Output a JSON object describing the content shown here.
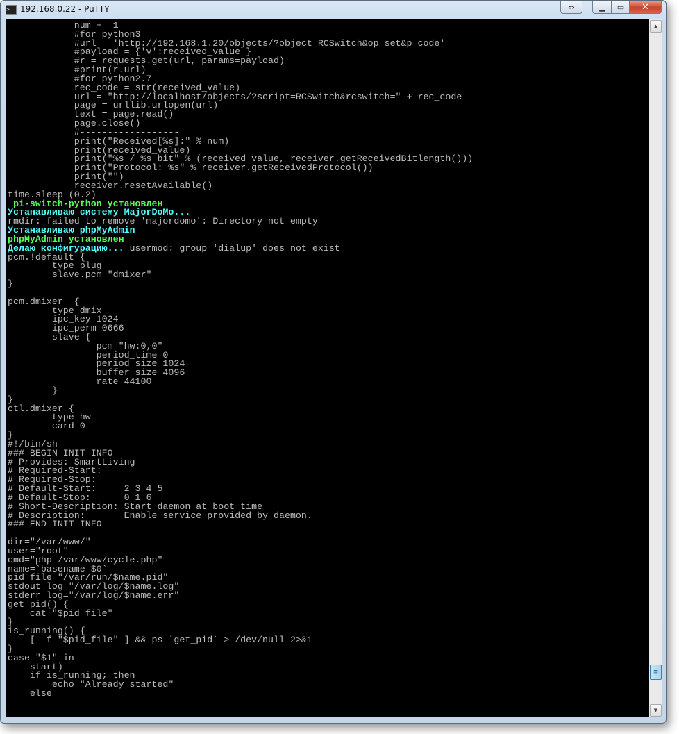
{
  "window": {
    "title": "192.168.0.22 - PuTTY",
    "buttons": {
      "resize": "⇔",
      "minimize": "▁",
      "maximize": "▭",
      "close": "✕"
    }
  },
  "colors": {
    "default": "#bbbbbb",
    "green": "#55ff55",
    "cyan": "#55ffff",
    "background": "#000000"
  },
  "scrollbar": {
    "position_percent": 96
  },
  "terminal": {
    "lines": [
      [
        {
          "t": "            num += 1"
        }
      ],
      [
        {
          "t": "            #for python3"
        }
      ],
      [
        {
          "t": "            #url = 'http://192.168.1.20/objects/?object=RCSwitch&op=set&p=code'"
        }
      ],
      [
        {
          "t": "            #payload = {'v':received_value }"
        }
      ],
      [
        {
          "t": "            #r = requests.get(url, params=payload)"
        }
      ],
      [
        {
          "t": "            #print(r.url)"
        }
      ],
      [
        {
          "t": "            #for python2.7"
        }
      ],
      [
        {
          "t": "            rec_code = str(received_value)"
        }
      ],
      [
        {
          "t": "            url = \"http://localhost/objects/?script=RCSwitch&rcswitch=\" + rec_code"
        }
      ],
      [
        {
          "t": "            page = urllib.urlopen(url)"
        }
      ],
      [
        {
          "t": "            text = page.read()"
        }
      ],
      [
        {
          "t": "            page.close()"
        }
      ],
      [
        {
          "t": "            #------------------"
        }
      ],
      [
        {
          "t": "            print(\"Received[%s]:\" % num)"
        }
      ],
      [
        {
          "t": "            print(received_value)"
        }
      ],
      [
        {
          "t": "            print(\"%s / %s bit\" % (received_value, receiver.getReceivedBitlength()))"
        }
      ],
      [
        {
          "t": "            print(\"Protocol: %s\" % receiver.getReceivedProtocol())"
        }
      ],
      [
        {
          "t": "            print(\"\")"
        }
      ],
      [
        {
          "t": "            receiver.resetAvailable()"
        }
      ],
      [
        {
          "t": "time.sleep (0.2)"
        }
      ],
      [
        {
          "t": " pi-switch-python установлен",
          "c": "green",
          "b": true
        }
      ],
      [
        {
          "t": "Устанавливаю систему MajorDoMo...",
          "c": "cyan",
          "b": true
        }
      ],
      [
        {
          "t": "rmdir: failed to remove 'majordomo': Directory not empty"
        }
      ],
      [
        {
          "t": "Устанавливаю phpMyAdmin",
          "c": "cyan",
          "b": true
        }
      ],
      [
        {
          "t": "phpMyAdmin установлен",
          "c": "green",
          "b": true
        }
      ],
      [
        {
          "t": "Делаю конфигурацию...",
          "c": "cyan",
          "b": true
        },
        {
          "t": " usermod: group 'dialup' does not exist"
        }
      ],
      [
        {
          "t": "pcm.!default {"
        }
      ],
      [
        {
          "t": "        type plug"
        }
      ],
      [
        {
          "t": "        slave.pcm \"dmixer\""
        }
      ],
      [
        {
          "t": "}"
        }
      ],
      [
        {
          "t": ""
        }
      ],
      [
        {
          "t": "pcm.dmixer  {"
        }
      ],
      [
        {
          "t": "        type dmix"
        }
      ],
      [
        {
          "t": "        ipc_key 1024"
        }
      ],
      [
        {
          "t": "        ipc_perm 0666"
        }
      ],
      [
        {
          "t": "        slave {"
        }
      ],
      [
        {
          "t": "                pcm \"hw:0,0\""
        }
      ],
      [
        {
          "t": "                period_time 0"
        }
      ],
      [
        {
          "t": "                period_size 1024"
        }
      ],
      [
        {
          "t": "                buffer_size 4096"
        }
      ],
      [
        {
          "t": "                rate 44100"
        }
      ],
      [
        {
          "t": "        }"
        }
      ],
      [
        {
          "t": "}"
        }
      ],
      [
        {
          "t": "ctl.dmixer {"
        }
      ],
      [
        {
          "t": "        type hw"
        }
      ],
      [
        {
          "t": "        card 0"
        }
      ],
      [
        {
          "t": "}"
        }
      ],
      [
        {
          "t": "#!/bin/sh"
        }
      ],
      [
        {
          "t": "### BEGIN INIT INFO"
        }
      ],
      [
        {
          "t": "# Provides: SmartLiving"
        }
      ],
      [
        {
          "t": "# Required-Start:"
        }
      ],
      [
        {
          "t": "# Required-Stop:"
        }
      ],
      [
        {
          "t": "# Default-Start:     2 3 4 5"
        }
      ],
      [
        {
          "t": "# Default-Stop:      0 1 6"
        }
      ],
      [
        {
          "t": "# Short-Description: Start daemon at boot time"
        }
      ],
      [
        {
          "t": "# Description:       Enable service provided by daemon."
        }
      ],
      [
        {
          "t": "### END INIT INFO"
        }
      ],
      [
        {
          "t": ""
        }
      ],
      [
        {
          "t": "dir=\"/var/www/\""
        }
      ],
      [
        {
          "t": "user=\"root\""
        }
      ],
      [
        {
          "t": "cmd=\"php /var/www/cycle.php\""
        }
      ],
      [
        {
          "t": "name=`basename $0`"
        }
      ],
      [
        {
          "t": "pid_file=\"/var/run/$name.pid\""
        }
      ],
      [
        {
          "t": "stdout_log=\"/var/log/$name.log\""
        }
      ],
      [
        {
          "t": "stderr_log=\"/var/log/$name.err\""
        }
      ],
      [
        {
          "t": "get_pid() {"
        }
      ],
      [
        {
          "t": "    cat \"$pid_file\""
        }
      ],
      [
        {
          "t": "}"
        }
      ],
      [
        {
          "t": "is_running() {"
        }
      ],
      [
        {
          "t": "    [ -f \"$pid_file\" ] && ps `get_pid` > /dev/null 2>&1"
        }
      ],
      [
        {
          "t": "}"
        }
      ],
      [
        {
          "t": "case \"$1\" in"
        }
      ],
      [
        {
          "t": "    start)"
        }
      ],
      [
        {
          "t": "    if is_running; then"
        }
      ],
      [
        {
          "t": "        echo \"Already started\""
        }
      ],
      [
        {
          "t": "    else"
        }
      ]
    ]
  }
}
